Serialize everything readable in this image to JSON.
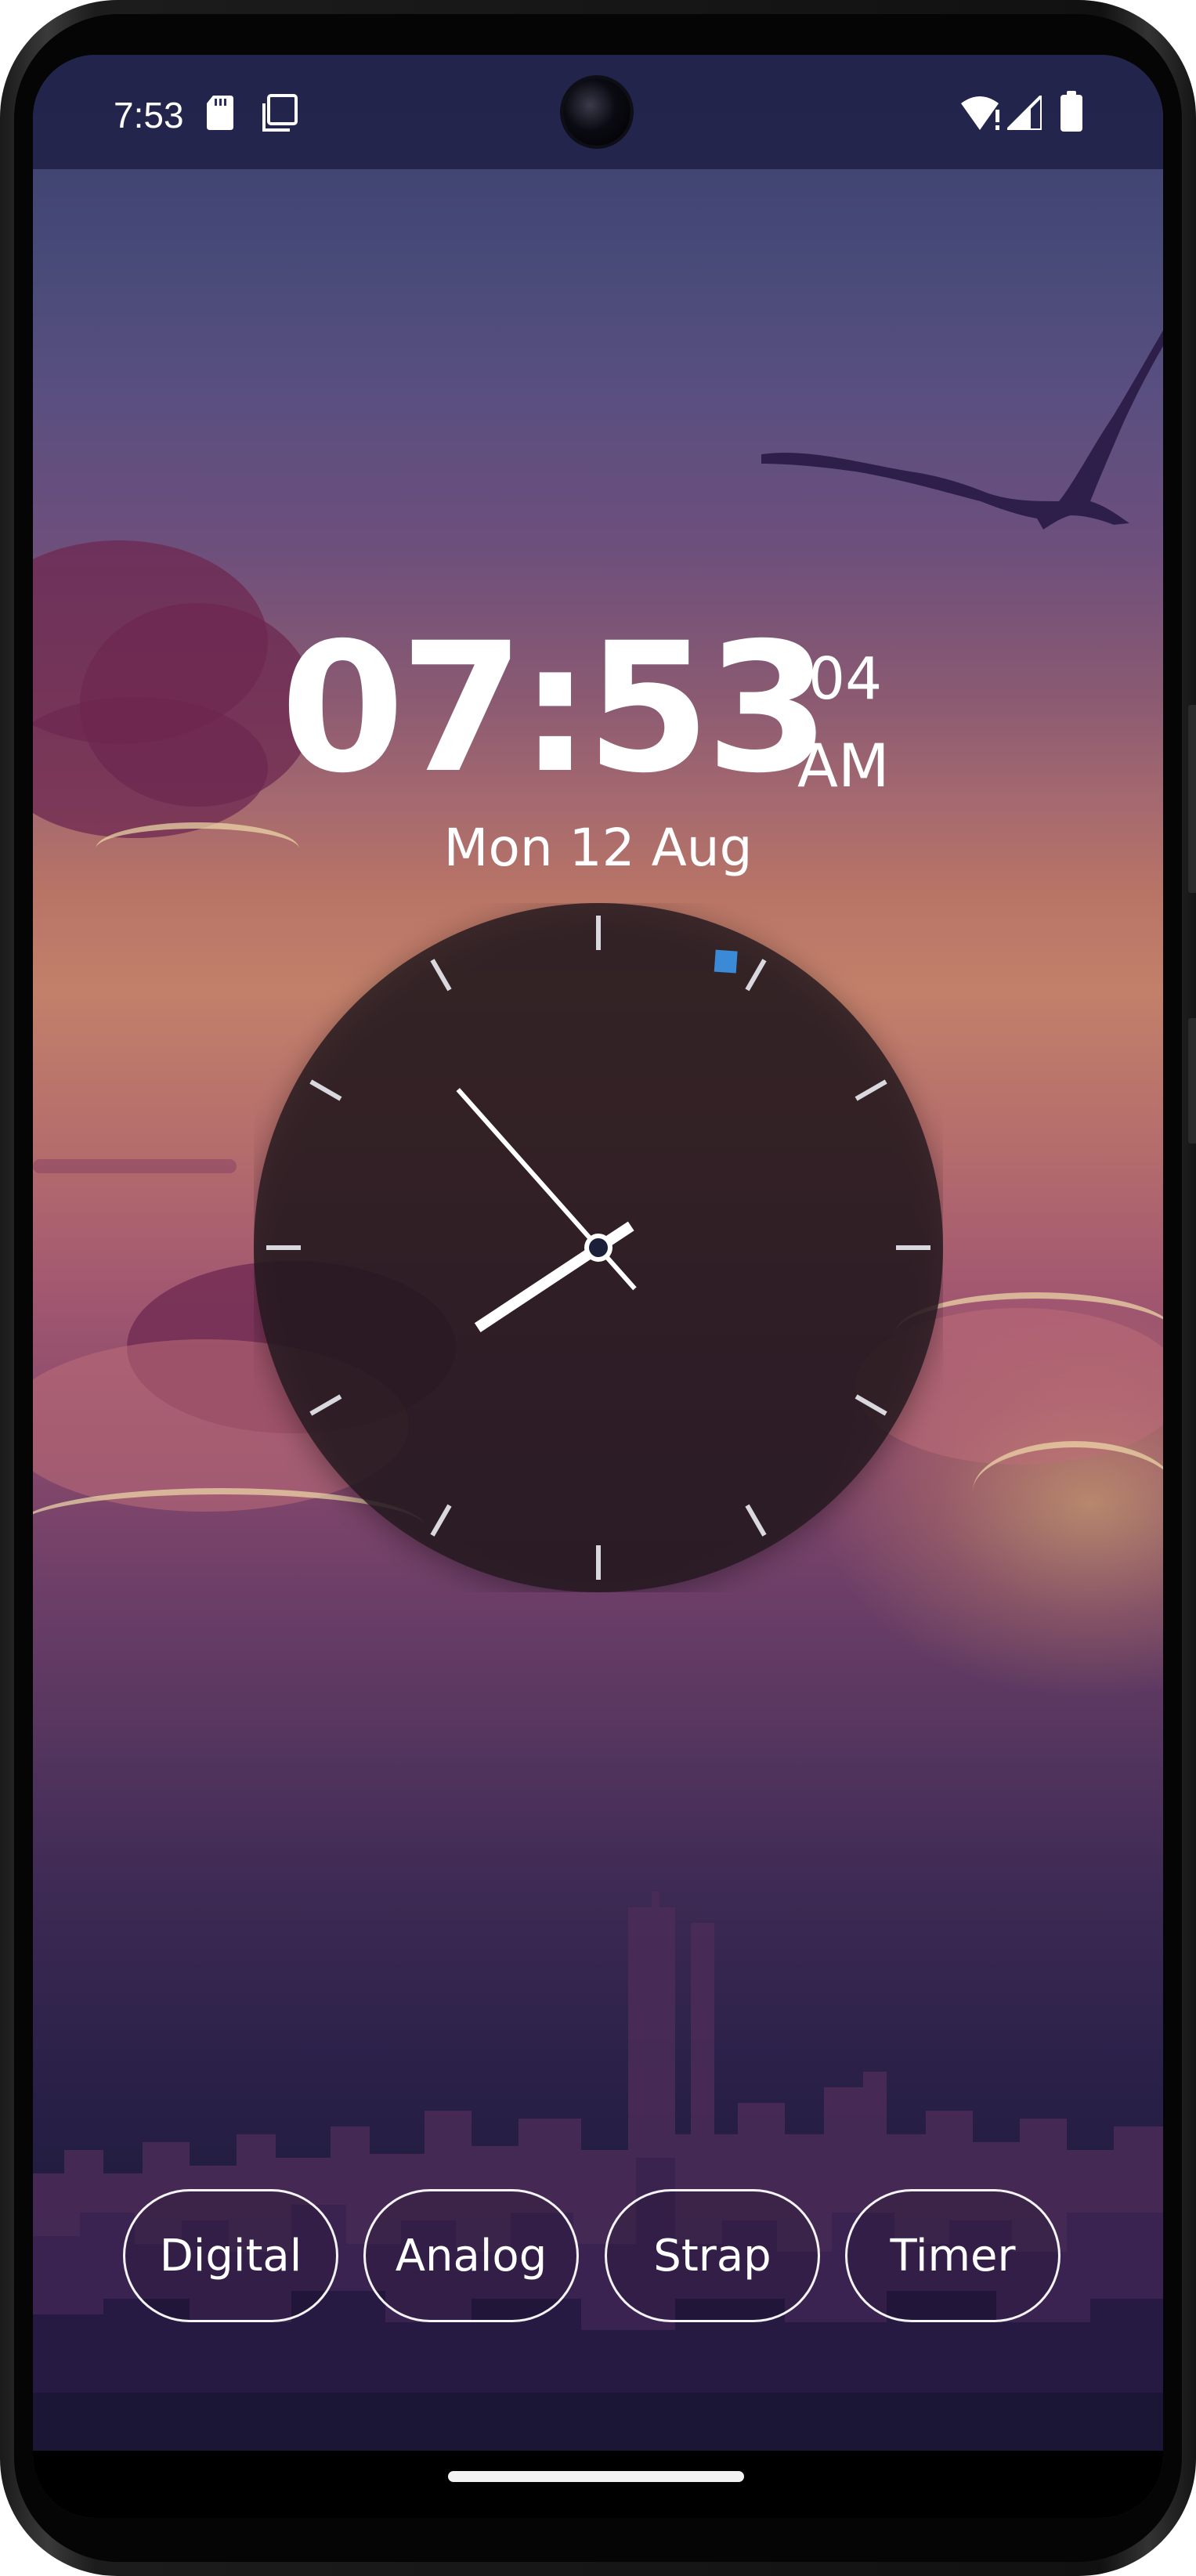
{
  "status_bar": {
    "time": "7:53",
    "icons": [
      "sd-card-icon",
      "screenshot-icon",
      "wifi-alert-icon",
      "cellular-signal-icon",
      "battery-icon"
    ]
  },
  "clock": {
    "time": "07:53",
    "seconds": "04",
    "ampm": "AM",
    "date": "Mon 12 Aug"
  },
  "analog_clock": {
    "hour": 7,
    "minute": 53,
    "second": 4,
    "accent_color": "#3a8ad8"
  },
  "tabs": [
    {
      "label": "Digital"
    },
    {
      "label": "Analog"
    },
    {
      "label": "Strap"
    },
    {
      "label": "Timer"
    }
  ],
  "colors": {
    "sky_top": "#3a3e6b",
    "sunset": "#c2806a",
    "tab_border": "#ffffff",
    "clock_face": "#2a1e22"
  }
}
